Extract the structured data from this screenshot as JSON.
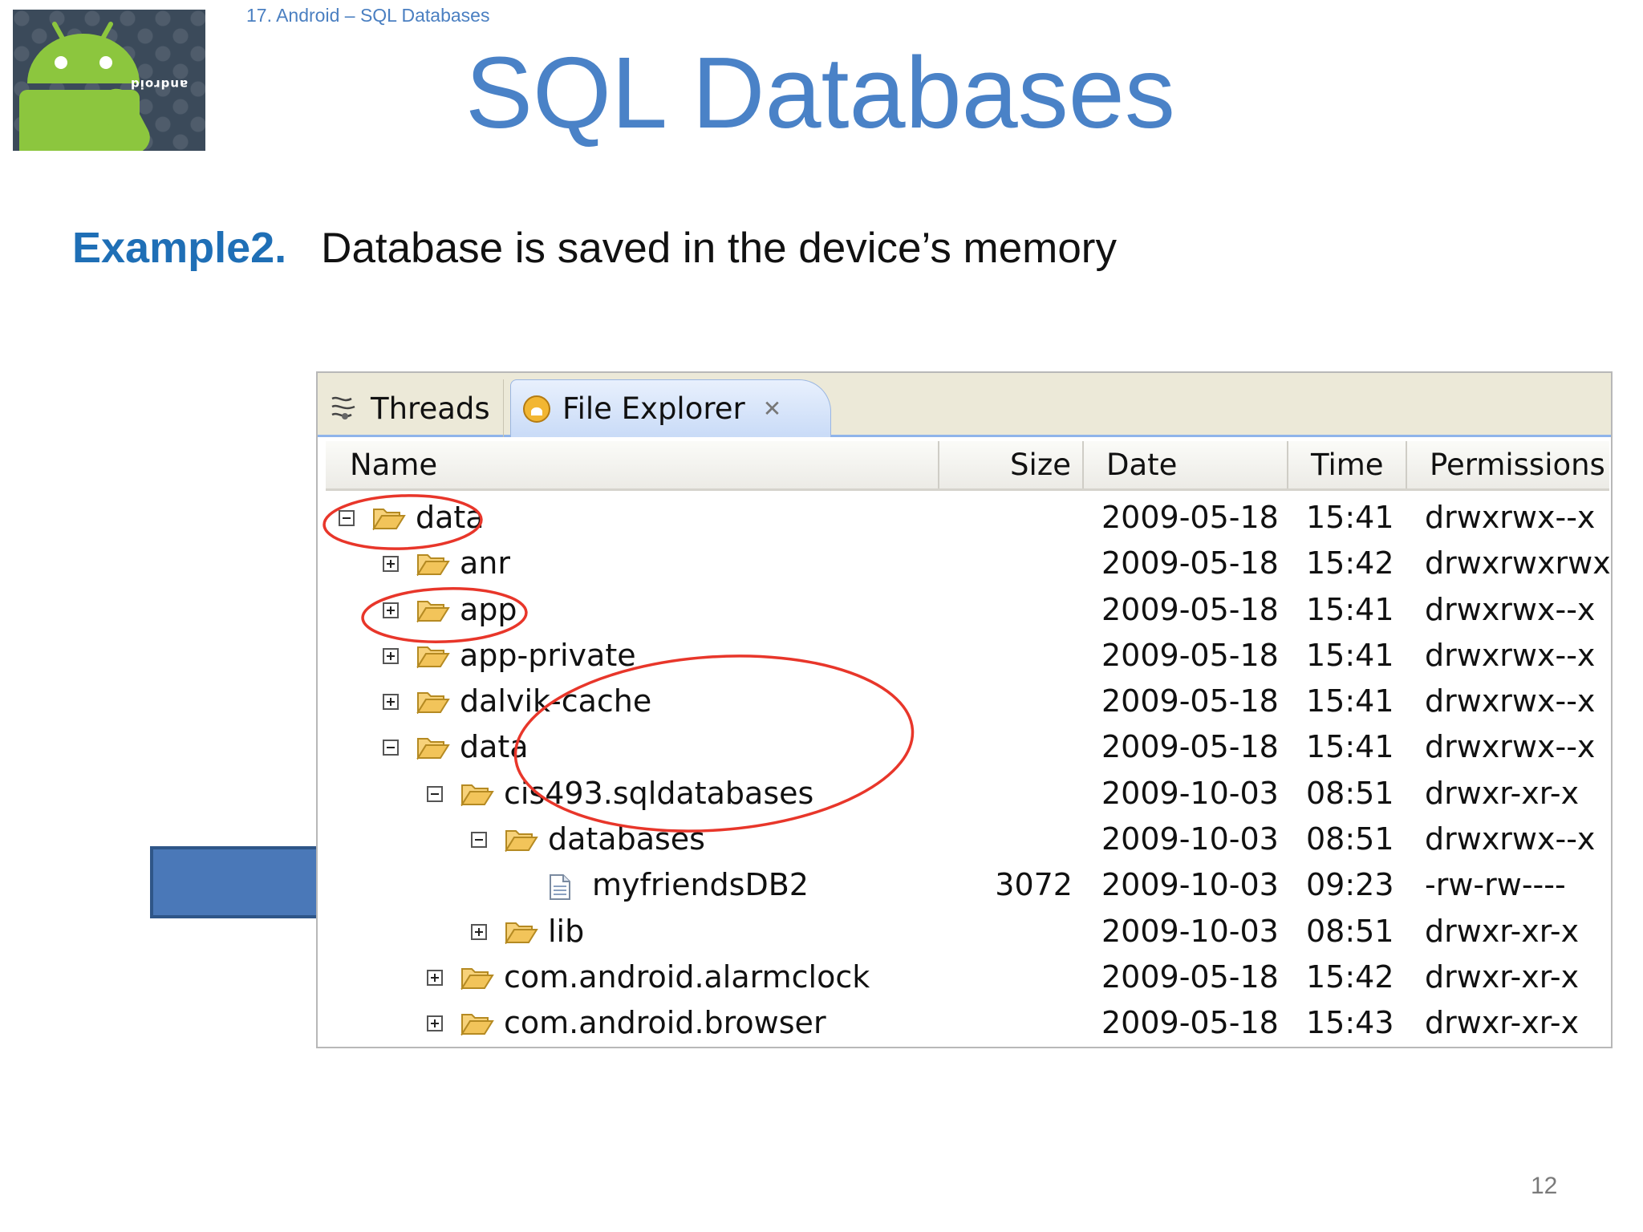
{
  "slide": {
    "breadcrumb": "17. Android – SQL Databases",
    "title": "SQL Databases",
    "example_label": "Example2.",
    "example_text": "Database is saved in the device’s memory",
    "page_number": "12",
    "logo_text": "android"
  },
  "explorer": {
    "tabs": [
      {
        "label": "Threads",
        "icon": "threads-icon"
      },
      {
        "label": "File Explorer",
        "icon": "android-icon",
        "active": true
      }
    ],
    "columns": [
      "Name",
      "Size",
      "Date",
      "Time",
      "Permissions"
    ],
    "rows": [
      {
        "level": 0,
        "toggle": "minus",
        "type": "folder",
        "name": "data",
        "size": "",
        "date": "2009-05-18",
        "time": "15:41",
        "permissions": "drwxrwx--x"
      },
      {
        "level": 1,
        "toggle": "plus",
        "type": "folder",
        "name": "anr",
        "size": "",
        "date": "2009-05-18",
        "time": "15:42",
        "permissions": "drwxrwxrwx"
      },
      {
        "level": 1,
        "toggle": "plus",
        "type": "folder",
        "name": "app",
        "size": "",
        "date": "2009-05-18",
        "time": "15:41",
        "permissions": "drwxrwx--x"
      },
      {
        "level": 1,
        "toggle": "plus",
        "type": "folder",
        "name": "app-private",
        "size": "",
        "date": "2009-05-18",
        "time": "15:41",
        "permissions": "drwxrwx--x"
      },
      {
        "level": 1,
        "toggle": "plus",
        "type": "folder",
        "name": "dalvik-cache",
        "size": "",
        "date": "2009-05-18",
        "time": "15:41",
        "permissions": "drwxrwx--x"
      },
      {
        "level": 1,
        "toggle": "minus",
        "type": "folder",
        "name": "data",
        "size": "",
        "date": "2009-05-18",
        "time": "15:41",
        "permissions": "drwxrwx--x"
      },
      {
        "level": 2,
        "toggle": "minus",
        "type": "folder",
        "name": "cis493.sqldatabases",
        "size": "",
        "date": "2009-10-03",
        "time": "08:51",
        "permissions": "drwxr-xr-x"
      },
      {
        "level": 3,
        "toggle": "minus",
        "type": "folder",
        "name": "databases",
        "size": "",
        "date": "2009-10-03",
        "time": "08:51",
        "permissions": "drwxrwx--x"
      },
      {
        "level": 4,
        "toggle": "none",
        "type": "file",
        "name": "myfriendsDB2",
        "size": "3072",
        "date": "2009-10-03",
        "time": "09:23",
        "permissions": "-rw-rw----"
      },
      {
        "level": 3,
        "toggle": "plus",
        "type": "folder",
        "name": "lib",
        "size": "",
        "date": "2009-10-03",
        "time": "08:51",
        "permissions": "drwxr-xr-x"
      },
      {
        "level": 2,
        "toggle": "plus",
        "type": "folder",
        "name": "com.android.alarmclock",
        "size": "",
        "date": "2009-05-18",
        "time": "15:42",
        "permissions": "drwxr-xr-x"
      },
      {
        "level": 2,
        "toggle": "plus",
        "type": "folder",
        "name": "com.android.browser",
        "size": "",
        "date": "2009-05-18",
        "time": "15:43",
        "permissions": "drwxr-xr-x"
      }
    ]
  },
  "colors": {
    "title_blue": "#4a82c7",
    "example_blue": "#1f6fb6",
    "arrow_blue": "#4a78b8",
    "annotation_red": "#e8362a",
    "folder_yellow": "#f2c45a",
    "android_green": "#8cc63e"
  }
}
